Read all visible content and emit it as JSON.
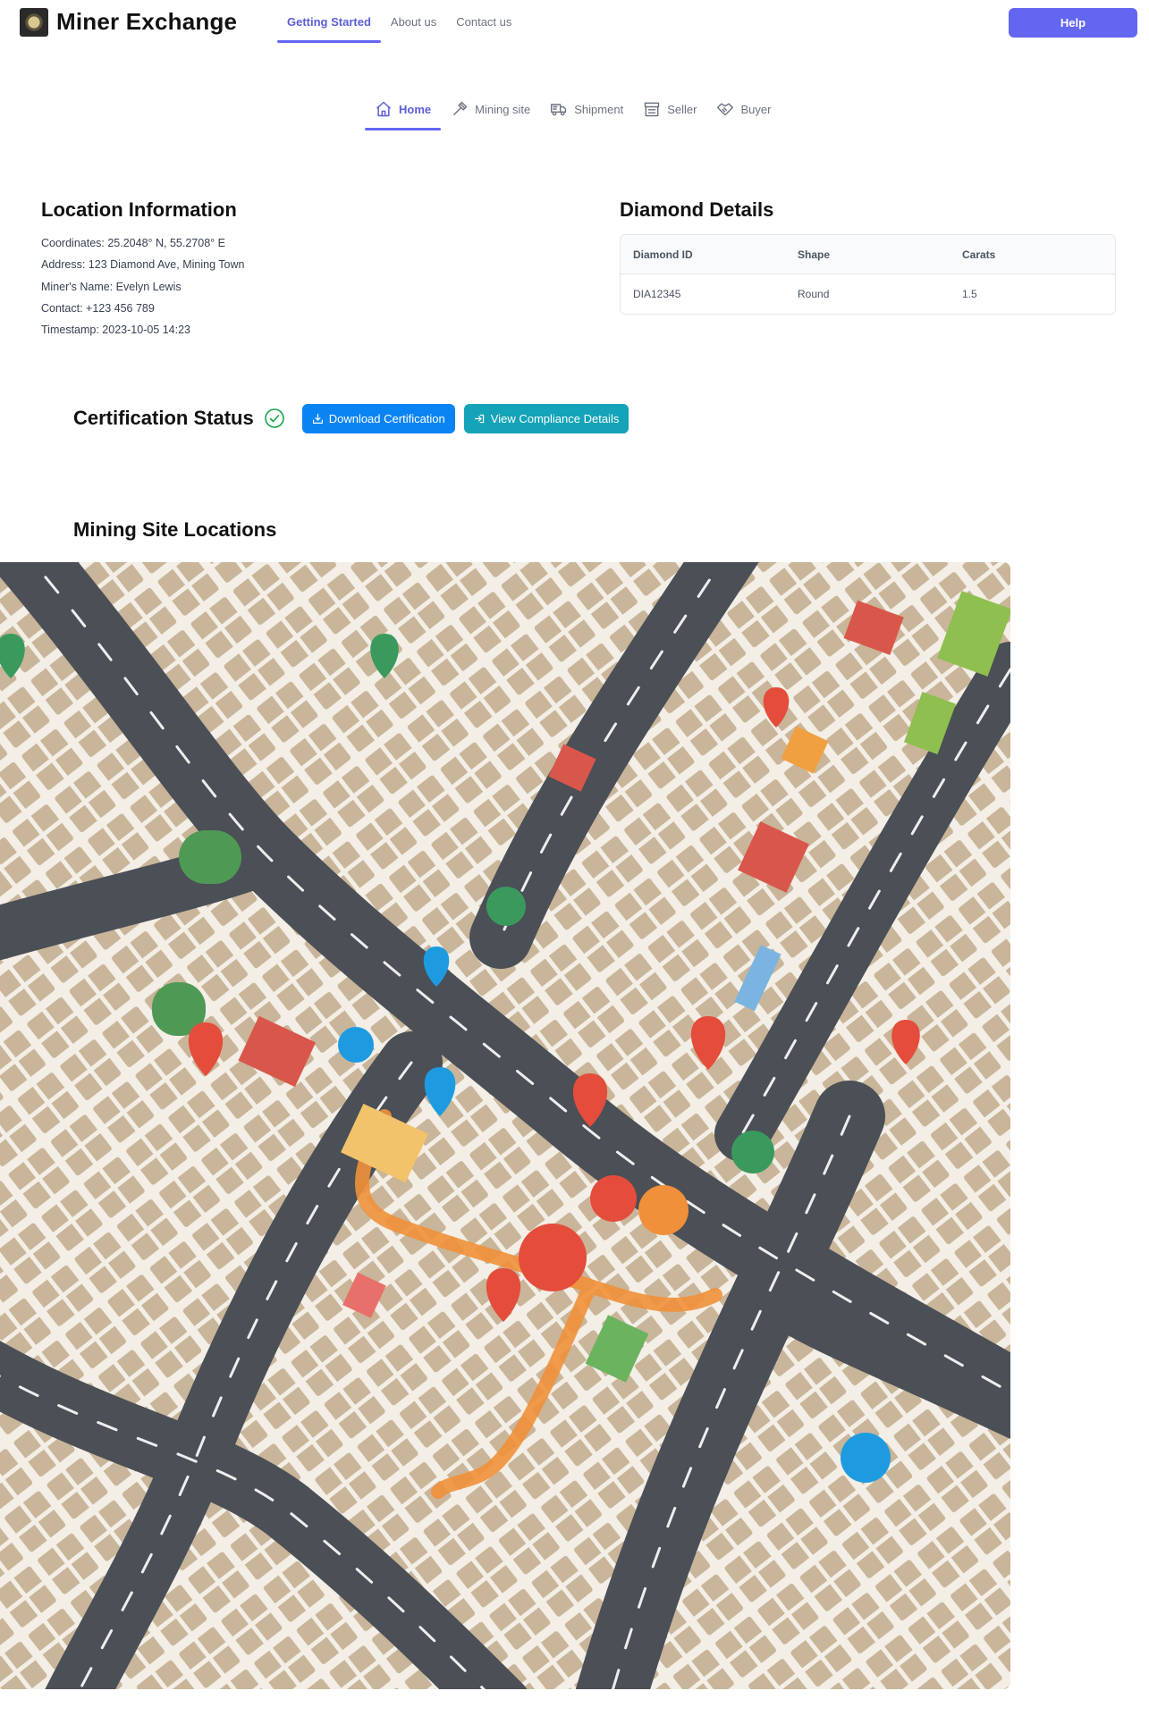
{
  "header": {
    "brand": "Miner Exchange",
    "nav": [
      "Getting Started",
      "About us",
      "Contact us"
    ],
    "help_label": "Help"
  },
  "tabs": [
    {
      "label": "Home",
      "icon": "home-icon"
    },
    {
      "label": "Mining site",
      "icon": "hammer-icon"
    },
    {
      "label": "Shipment",
      "icon": "truck-icon"
    },
    {
      "label": "Seller",
      "icon": "store-icon"
    },
    {
      "label": "Buyer",
      "icon": "handshake-icon"
    }
  ],
  "location": {
    "title": "Location Information",
    "lines": [
      "Coordinates: 25.2048° N, 55.2708° E",
      "Address: 123 Diamond Ave, Mining Town",
      "Miner's Name: Evelyn Lewis",
      "Contact: +123 456 789",
      "Timestamp: 2023-10-05 14:23"
    ]
  },
  "diamond": {
    "title": "Diamond Details",
    "headers": [
      "Diamond ID",
      "Shape",
      "Carats"
    ],
    "row": [
      "DIA12345",
      "Round",
      "1.5"
    ]
  },
  "certification": {
    "title": "Certification Status",
    "download_label": "Download Certification",
    "compliance_label": "View Compliance Details"
  },
  "map": {
    "title": "Mining Site Locations"
  },
  "colors": {
    "accent": "#6366f1",
    "download": "#0b84f3",
    "compliance": "#14a3b8",
    "status_ok": "#16a34a"
  }
}
